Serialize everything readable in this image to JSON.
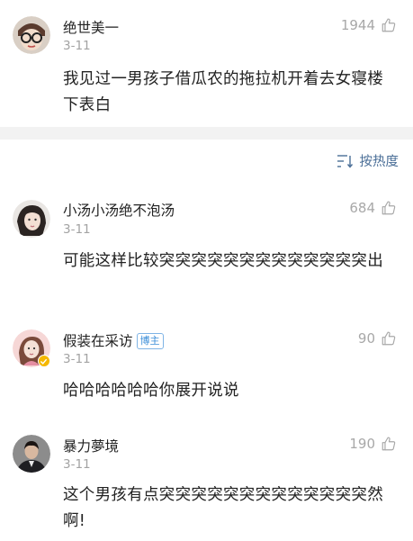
{
  "comments": [
    {
      "username": "绝世美一",
      "date": "3-11",
      "likes": "1944",
      "text": "我见过一男孩子借瓜农的拖拉机开着去女寝楼下表白",
      "avatar": "avatar-sunglasses-cartoon"
    },
    {
      "username": "小汤小汤绝不泡汤",
      "date": "3-11",
      "likes": "684",
      "text": "可能这样比较突突突突突突突突突突突突突出",
      "avatar": "avatar-girl-photo"
    },
    {
      "username": "假装在采访",
      "badge": "博主",
      "date": "3-11",
      "likes": "90",
      "text": "哈哈哈哈哈哈你展开说说",
      "avatar": "avatar-pink-girl-verified"
    },
    {
      "username": "暴力夢境",
      "date": "3-11",
      "likes": "190",
      "text": "这个男孩有点突突突突突突突突突突突突突然啊!",
      "avatar": "avatar-man-suit-photo"
    }
  ],
  "sort": {
    "label": "按热度",
    "icon": "sort-lines-icon"
  },
  "colors": {
    "link": "#4a6e97",
    "muted": "#a3a3a3",
    "divider": "#f2f2f2",
    "badge": "#3b8ed8",
    "verified": "#f5b800"
  },
  "icons": {
    "like": "thumbs-up-icon"
  }
}
